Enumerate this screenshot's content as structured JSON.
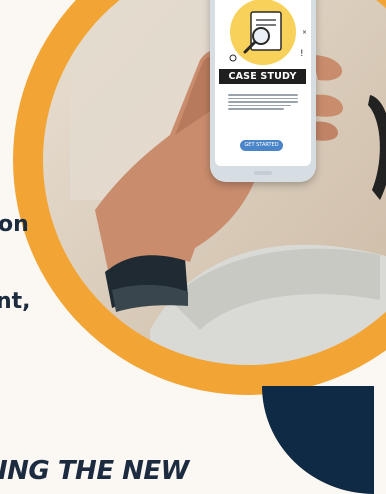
{
  "colors": {
    "background": "#fbf8f3",
    "orange": "#f2a534",
    "navy": "#0f2a44",
    "text": "#1c2b3f"
  },
  "text_fragments": [
    "on",
    "nt,",
    "ING THE NEW"
  ],
  "phone": {
    "banner": "CASE STUDY",
    "button": "GET STARTED",
    "icon": "magnifier-on-document-icon"
  }
}
